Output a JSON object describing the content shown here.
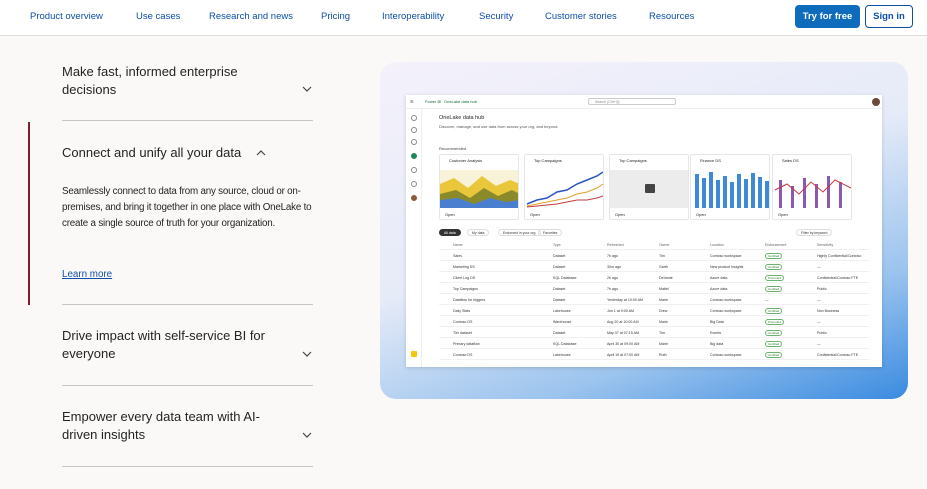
{
  "nav": {
    "links": [
      "Product overview",
      "Use cases",
      "Research and news",
      "Pricing",
      "Interoperability",
      "Security",
      "Customer stories",
      "Resources"
    ],
    "try_label": "Try for free",
    "sign_label": "Sign in"
  },
  "accordion": {
    "items": [
      {
        "title": "Make fast, informed enterprise decisions",
        "expanded": false
      },
      {
        "title": "Connect and unify all your data",
        "expanded": true
      },
      {
        "title": "Drive impact with self-service BI for everyone",
        "expanded": false
      },
      {
        "title": "Empower every data team with AI-driven insights",
        "expanded": false
      }
    ],
    "body": "Seamlessly connect to data from any source, cloud or on-premises, and bring it together in one place with OneLake to create a single source of truth for your organization.",
    "learn_more": "Learn more"
  },
  "app": {
    "product": "Power BI",
    "search": "Search (Ctrl+Q)",
    "hub_title": "OneLake data hub",
    "hub_sub": "Discover, manage, and use data from across your org, and beyond.",
    "recommended": "Recommended",
    "cards": [
      {
        "title": "Customer Analysis"
      },
      {
        "title": "Top Campaigns"
      },
      {
        "title": "Top Campaigns"
      },
      {
        "title": "Finance DS"
      },
      {
        "title": "Sales DS"
      }
    ],
    "open": "Open",
    "filters": [
      "All data",
      "My data",
      "Endorsed in your org",
      "Favorites"
    ],
    "filter_keyword": "Filter by keyword",
    "columns": [
      "Name",
      "Type",
      "Refreshed",
      "Owner",
      "Location",
      "Endorsement",
      "Sensitivity"
    ],
    "rows": [
      {
        "name": "Sales",
        "type": "Dataset",
        "refreshed": "7h ago",
        "owner": "Tim",
        "location": "Contoso workspace",
        "endorsement": "Certified",
        "sensitivity": "Highly Confidential\\Contoso"
      },
      {
        "name": "Marketing DS",
        "type": "Dataset",
        "refreshed": "30m ago",
        "owner": "Garth",
        "location": "New product insights",
        "endorsement": "Certified",
        "sensitivity": "—"
      },
      {
        "name": "Client Log DS",
        "type": "KQL Database",
        "refreshed": "2h ago",
        "owner": "DeVante",
        "location": "Azure data",
        "endorsement": "Promoted",
        "sensitivity": "Confidential\\Contoso FTE"
      },
      {
        "name": "Top Campaigns",
        "type": "Dataset",
        "refreshed": "7h ago",
        "owner": "Mattel",
        "location": "Azure data",
        "endorsement": "Certified",
        "sensitivity": "Public"
      },
      {
        "name": "Dataflow for triggers",
        "type": "Dataset",
        "refreshed": "Yesterday at 10:00 AM",
        "owner": "Marie",
        "location": "Contoso workspace",
        "endorsement": "—",
        "sensitivity": "—"
      },
      {
        "name": "Daily Stats",
        "type": "Lakehouse",
        "refreshed": "Jun 1 at 9:00 AM",
        "owner": "Drew",
        "location": "Contoso workspace",
        "endorsement": "Certified",
        "sensitivity": "Non Business"
      },
      {
        "name": "Contoso DS",
        "type": "Warehouse",
        "refreshed": "Aug 20 at 10:00 AM",
        "owner": "Marie",
        "location": "Big Data",
        "endorsement": "Promoted",
        "sensitivity": "—"
      },
      {
        "name": "Tier dataset",
        "type": "Dataset",
        "refreshed": "May 07 at 07:15 AM",
        "owner": "Tim",
        "location": "Events",
        "endorsement": "Certified",
        "sensitivity": "Public"
      },
      {
        "name": "Primary dataflow",
        "type": "KQL Database",
        "refreshed": "April 30 at 09:00 AM",
        "owner": "Marie",
        "location": "Big data",
        "endorsement": "Certified",
        "sensitivity": "—"
      },
      {
        "name": "Contoso DS",
        "type": "Lakehouse",
        "refreshed": "April 19 at 07:00 AM",
        "owner": "Ruth",
        "location": "Contoso workspace",
        "endorsement": "Certified",
        "sensitivity": "Confidential\\Contoso FTE"
      }
    ]
  }
}
